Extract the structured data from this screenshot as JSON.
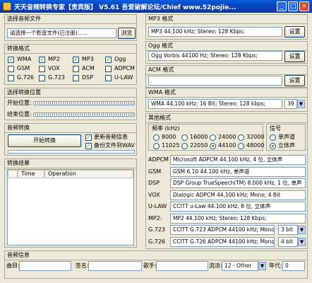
{
  "window": {
    "title": "天天音频转换专家【贵宾版】 V5.61      吾爱破解论坛/Chief  www.52pojie...",
    "min": "_",
    "max": "□",
    "close": "×"
  },
  "source": {
    "title": "选择音频文件",
    "placeholder": "请选择一个影音文件(已注册)......",
    "browse": "浏览"
  },
  "formats": {
    "title": "转换格式",
    "items": [
      {
        "label": "WMA",
        "checked": true
      },
      {
        "label": "MP2",
        "checked": true
      },
      {
        "label": "MP3",
        "checked": true
      },
      {
        "label": "Ogg",
        "checked": true
      },
      {
        "label": "GSM",
        "checked": false
      },
      {
        "label": "VOX",
        "checked": false
      },
      {
        "label": "ACM",
        "checked": false
      },
      {
        "label": "ADPCM",
        "checked": false
      },
      {
        "label": "G.726",
        "checked": false
      },
      {
        "label": "G.723",
        "checked": false
      },
      {
        "label": "DSP",
        "checked": false
      },
      {
        "label": "U-LAW",
        "checked": false
      }
    ]
  },
  "position": {
    "title": "选择转换位置",
    "start": "开始位置:",
    "end": "结束位置:"
  },
  "convert": {
    "title": "音频转换",
    "start_button": "开始转换",
    "update_info": "更新音频信息",
    "backup_wav": "备份文件到WAV"
  },
  "results": {
    "title": "转换结果",
    "col_time": "Time",
    "col_op": "Operation"
  },
  "mp3": {
    "title": "MP3 格式",
    "value": "MP3 44,100 kHz; Stereo;  128 Kbps;",
    "setup": "设置"
  },
  "ogg": {
    "title": "Ogg 格式",
    "value": "Ogg Vorbis 44100 Hz; Stereo; 128 Kbps;",
    "setup": "设置"
  },
  "acm": {
    "title": "ACM 格式",
    "value": "",
    "setup": "设置"
  },
  "wma": {
    "title": "WMA 格式",
    "value": "WMA 44,100 kHz; 16 Bit; Stereo; 128 kbps;",
    "combo": "39"
  },
  "other": {
    "title": "其他格式",
    "freq_title": "频率 (kHz)",
    "freqs": [
      {
        "label": "8000",
        "on": false
      },
      {
        "label": "16000",
        "on": false
      },
      {
        "label": "24000",
        "on": false
      },
      {
        "label": "32000",
        "on": false
      },
      {
        "label": "11025",
        "on": false
      },
      {
        "label": "22050",
        "on": false
      },
      {
        "label": "44100",
        "on": true
      },
      {
        "label": "48000",
        "on": false
      }
    ],
    "channel_title": "信号",
    "mono": "单声道",
    "stereo": "立体声",
    "stereo_on": true,
    "rows": [
      {
        "label": "ADPCM",
        "value": "Microsoft ADPCM 44,100 kHz, 4 位, 立体声"
      },
      {
        "label": "GSM",
        "value": "GSM 6.10 44.100 kHz, 单声道"
      },
      {
        "label": "DSP",
        "value": "DSP Group TrueSpeech(TM) 8.000 kHz, 1 位, 单声"
      },
      {
        "label": "VOX",
        "value": "Dialogic ADPCM 44,100 kHz; Mono; 4 Bit"
      },
      {
        "label": "U-LAW",
        "value": "CCITT u-Law 44.100 kHz, 8 位, 立体声"
      },
      {
        "label": "MP2:",
        "value": "MP2 44,100 kHz; Stereo;  128 Kbps;"
      },
      {
        "label": "G.723",
        "value": "CCITT G.723 ADPCM 44100 kHz; Mono; 3",
        "combo": "3 bit"
      },
      {
        "label": "G.726",
        "value": "CCITT G.726 ADPCM 44100 kHz; Mono; 4",
        "combo": "4 bit"
      }
    ]
  },
  "info": {
    "title": "音频信息",
    "track": "曲目:",
    "name": "签名:",
    "artist": "歌手:",
    "genre": "流派:",
    "genre_value": "12 - Other",
    "year": "年代:",
    "year_value": "0"
  }
}
